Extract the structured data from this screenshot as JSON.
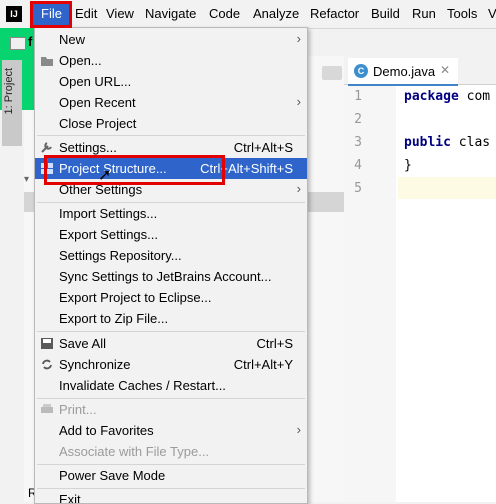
{
  "menubar": {
    "app_icon": "IJ",
    "items": [
      "File",
      "Edit",
      "View",
      "Navigate",
      "Code",
      "Analyze",
      "Refactor",
      "Build",
      "Run",
      "Tools",
      "V"
    ]
  },
  "project": {
    "tab_label": "1: Project",
    "root_letter": "f"
  },
  "editor": {
    "tab_label": "Demo.java",
    "tab_icon": "C",
    "line_numbers": [
      "1",
      "2",
      "3",
      "4",
      "5"
    ],
    "lines": [
      {
        "kw": "package",
        "rest": " com"
      },
      {
        "kw": "",
        "rest": ""
      },
      {
        "kw": "public",
        "rest": " clas"
      },
      {
        "kw": "",
        "rest": "}"
      },
      {
        "kw": "",
        "rest": ""
      }
    ]
  },
  "file_menu": {
    "items": [
      {
        "label": "New",
        "shortcut": "",
        "submenu": true,
        "icon": ""
      },
      {
        "label": "Open...",
        "shortcut": "",
        "submenu": false,
        "icon": "folder-icon"
      },
      {
        "label": "Open URL...",
        "shortcut": "",
        "submenu": false,
        "icon": ""
      },
      {
        "label": "Open Recent",
        "shortcut": "",
        "submenu": true,
        "icon": ""
      },
      {
        "label": "Close Project",
        "shortcut": "",
        "submenu": false,
        "icon": ""
      },
      {
        "label": "Settings...",
        "shortcut": "Ctrl+Alt+S",
        "submenu": false,
        "icon": "wrench-icon"
      },
      {
        "label": "Project Structure...",
        "shortcut": "Ctrl+Alt+Shift+S",
        "submenu": false,
        "icon": "structure-icon",
        "selected": true
      },
      {
        "label": "Other Settings",
        "shortcut": "",
        "submenu": true,
        "icon": ""
      },
      {
        "label": "Import Settings...",
        "shortcut": "",
        "submenu": false,
        "icon": ""
      },
      {
        "label": "Export Settings...",
        "shortcut": "",
        "submenu": false,
        "icon": ""
      },
      {
        "label": "Settings Repository...",
        "shortcut": "",
        "submenu": false,
        "icon": ""
      },
      {
        "label": "Sync Settings to JetBrains Account...",
        "shortcut": "",
        "submenu": false,
        "icon": ""
      },
      {
        "label": "Export Project to Eclipse...",
        "shortcut": "",
        "submenu": false,
        "icon": ""
      },
      {
        "label": "Export to Zip File...",
        "shortcut": "",
        "submenu": false,
        "icon": ""
      },
      {
        "label": "Save All",
        "shortcut": "Ctrl+S",
        "submenu": false,
        "icon": "save-icon"
      },
      {
        "label": "Synchronize",
        "shortcut": "Ctrl+Alt+Y",
        "submenu": false,
        "icon": "sync-icon"
      },
      {
        "label": "Invalidate Caches / Restart...",
        "shortcut": "",
        "submenu": false,
        "icon": ""
      },
      {
        "label": "Print...",
        "shortcut": "",
        "submenu": false,
        "icon": "print-icon",
        "disabled": true
      },
      {
        "label": "Add to Favorites",
        "shortcut": "",
        "submenu": true,
        "icon": ""
      },
      {
        "label": "Associate with File Type...",
        "shortcut": "",
        "submenu": false,
        "icon": "",
        "disabled": true
      },
      {
        "label": "Power Save Mode",
        "shortcut": "",
        "submenu": false,
        "icon": ""
      },
      {
        "label": "Exit",
        "shortcut": "",
        "submenu": false,
        "icon": ""
      }
    ]
  },
  "bottom_left_letter": "R",
  "colors": {
    "selection": "#2f65ca",
    "annotation_red": "#e30000",
    "green_overlay": "#08d46f",
    "keyword": "#000080"
  }
}
